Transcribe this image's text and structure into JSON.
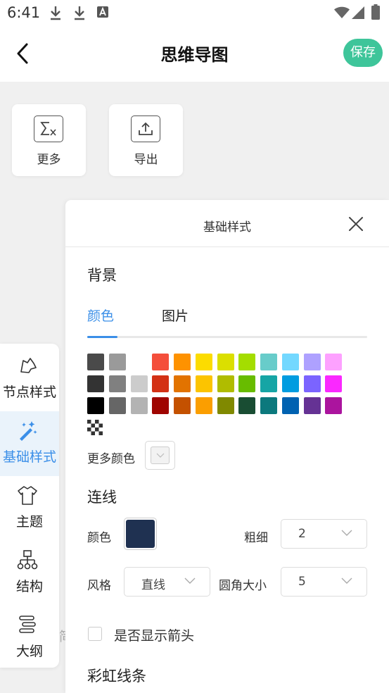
{
  "status_bar": {
    "time": "6:41"
  },
  "header": {
    "title": "思维导图",
    "save_label": "保存"
  },
  "toolbar": {
    "more_label": "更多",
    "export_label": "导出"
  },
  "side_tabs": [
    {
      "label": "节点样式",
      "icon": "node-style-icon",
      "active": false
    },
    {
      "label": "基础样式",
      "icon": "magic-wand-icon",
      "active": true
    },
    {
      "label": "主题",
      "icon": "shirt-icon",
      "active": false
    },
    {
      "label": "结构",
      "icon": "structure-icon",
      "active": false
    },
    {
      "label": "大纲",
      "icon": "outline-icon",
      "active": false
    }
  ],
  "partial_text": "简",
  "panel": {
    "title": "基础样式",
    "background": {
      "title": "背景",
      "tabs": [
        {
          "label": "颜色",
          "active": true
        },
        {
          "label": "图片",
          "active": false
        }
      ],
      "swatch_rows": [
        [
          "#4a4a4a",
          "#9a9a9a",
          "#ffffff",
          "#f44e3b",
          "#fe9200",
          "#fcdc00",
          "#dbdf00",
          "#a4dd00",
          "#68ccca",
          "#73d8ff",
          "#aea1ff",
          "#fda1ff"
        ],
        [
          "#333333",
          "#808080",
          "#cccccc",
          "#d33115",
          "#e27300",
          "#fcc400",
          "#b0bc00",
          "#68bc00",
          "#16a5a5",
          "#009ce0",
          "#7b64ff",
          "#fa28ff"
        ],
        [
          "#000000",
          "#666666",
          "#b3b3b3",
          "#9f0500",
          "#c45100",
          "#fb9e00",
          "#808900",
          "#194d33",
          "#0c797d",
          "#0062b1",
          "#653294",
          "#ab149e"
        ]
      ],
      "more_colors_label": "更多颜色"
    },
    "lines": {
      "title": "连线",
      "color_label": "颜色",
      "color_value": "#1f3151",
      "width_label": "粗细",
      "width_value": "2",
      "style_label": "风格",
      "style_value": "直线",
      "corner_label": "圆角大小",
      "corner_value": "5",
      "arrow_label": "是否显示箭头"
    },
    "rainbow_title": "彩虹线条"
  },
  "colors": {
    "accent": "#3b8fe8",
    "save": "#3ec59a"
  }
}
